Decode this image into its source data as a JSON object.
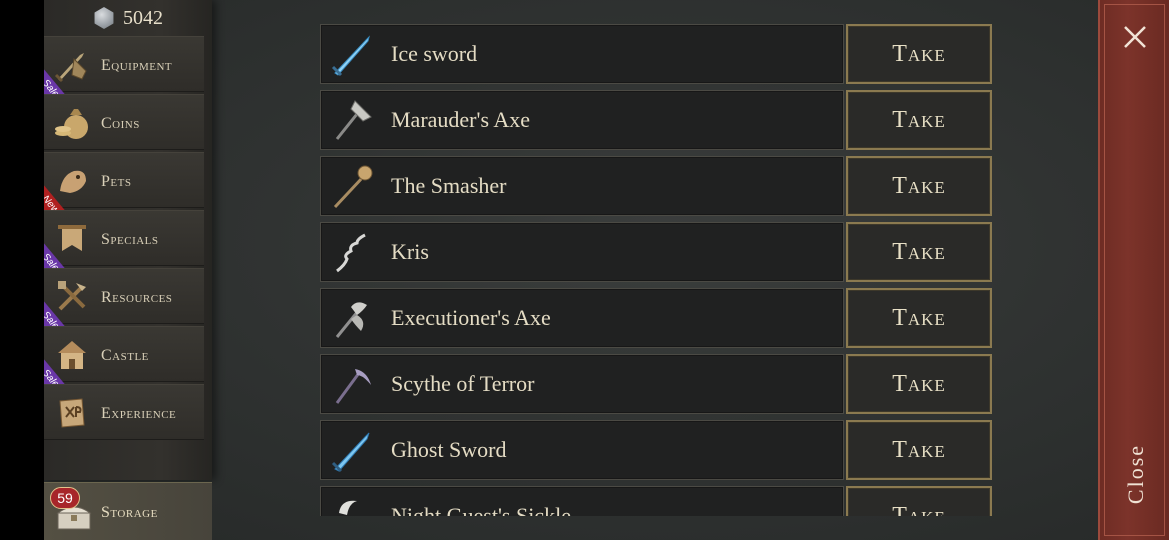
{
  "currency": {
    "amount": "5042",
    "icon": "silver-gem-icon"
  },
  "sidebar": {
    "items": [
      {
        "label": "Equipment",
        "icon": "sword-shield-icon",
        "ribbon": "Sale"
      },
      {
        "label": "Coins",
        "icon": "coin-bag-icon",
        "ribbon": ""
      },
      {
        "label": "Pets",
        "icon": "pet-icon",
        "ribbon": "New"
      },
      {
        "label": "Specials",
        "icon": "banner-icon",
        "ribbon": "Sale"
      },
      {
        "label": "Resources",
        "icon": "tools-icon",
        "ribbon": "Sale"
      },
      {
        "label": "Castle",
        "icon": "castle-icon",
        "ribbon": "Sale"
      },
      {
        "label": "Experience",
        "icon": "xp-scroll-icon",
        "ribbon": ""
      }
    ],
    "storage": {
      "label": "Storage",
      "badge": "59",
      "icon": "chest-icon"
    }
  },
  "items": [
    {
      "name": "Ice sword",
      "button": "Take",
      "icon": "ice-sword-icon"
    },
    {
      "name": "Marauder's Axe",
      "button": "Take",
      "icon": "axe-icon"
    },
    {
      "name": "The Smasher",
      "button": "Take",
      "icon": "mace-icon"
    },
    {
      "name": "Kris",
      "button": "Take",
      "icon": "kris-icon"
    },
    {
      "name": "Executioner's Axe",
      "button": "Take",
      "icon": "double-axe-icon"
    },
    {
      "name": "Scythe of Terror",
      "button": "Take",
      "icon": "scythe-icon"
    },
    {
      "name": "Ghost Sword",
      "button": "Take",
      "icon": "ghost-sword-icon"
    },
    {
      "name": "Night Guest's Sickle",
      "button": "Take",
      "icon": "sickle-icon"
    }
  ],
  "close": {
    "label": "Close",
    "icon": "close-icon"
  },
  "colors": {
    "accent": "#8b7a50",
    "close_panel": "#7c332a",
    "sale": "#6a37a8",
    "new": "#b02020"
  }
}
